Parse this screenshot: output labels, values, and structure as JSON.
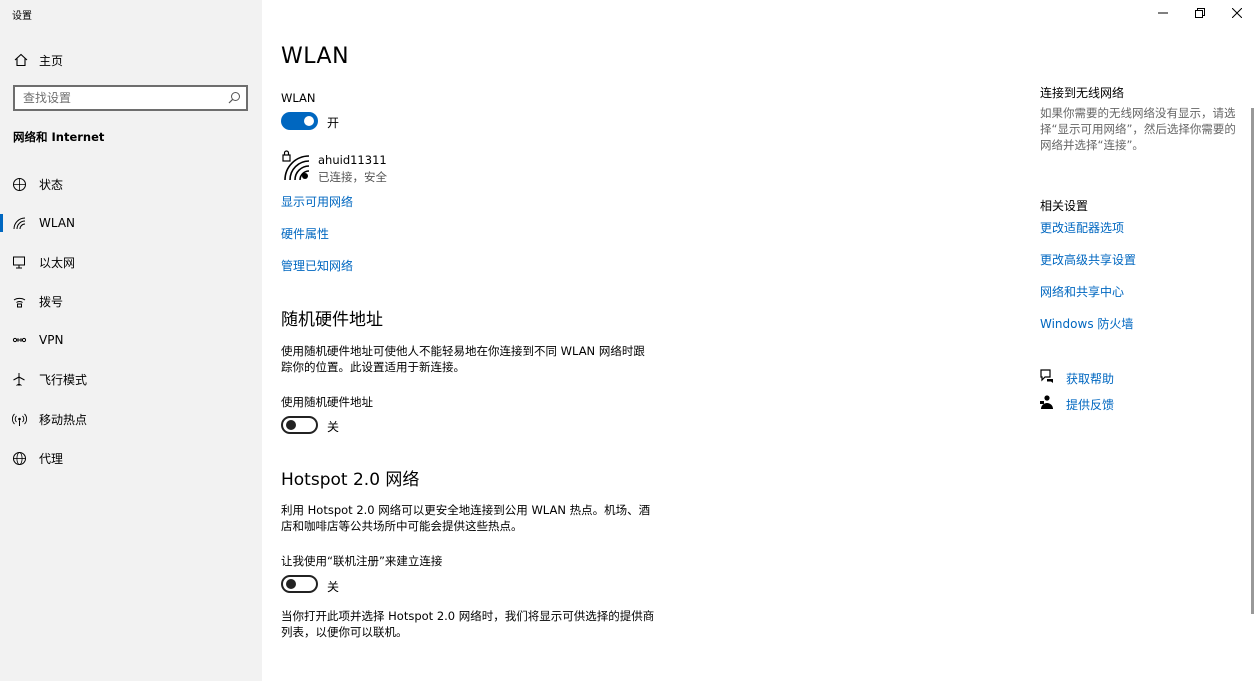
{
  "window": {
    "title": "设置"
  },
  "sidebar": {
    "home_label": "主页",
    "search_placeholder": "查找设置",
    "section_title": "网络和 Internet",
    "items": [
      {
        "label": "状态",
        "icon": "status-icon"
      },
      {
        "label": "WLAN",
        "icon": "wifi-icon",
        "active": true
      },
      {
        "label": "以太网",
        "icon": "ethernet-icon"
      },
      {
        "label": "拨号",
        "icon": "dialup-icon"
      },
      {
        "label": "VPN",
        "icon": "vpn-icon"
      },
      {
        "label": "飞行模式",
        "icon": "airplane-icon"
      },
      {
        "label": "移动热点",
        "icon": "hotspot-icon"
      },
      {
        "label": "代理",
        "icon": "globe-icon"
      }
    ]
  },
  "main": {
    "title": "WLAN",
    "wlan_label": "WLAN",
    "wlan_toggle_state": "开",
    "network": {
      "name": "ahuid11311",
      "status": "已连接，安全"
    },
    "links": [
      "显示可用网络",
      "硬件属性",
      "管理已知网络"
    ],
    "random_hw": {
      "heading": "随机硬件地址",
      "description": "使用随机硬件地址可使他人不能轻易地在你连接到不同 WLAN 网络时跟踪你的位置。此设置适用于新连接。",
      "toggle_label": "使用随机硬件地址",
      "toggle_state": "关"
    },
    "hotspot": {
      "heading": "Hotspot 2.0 网络",
      "description": "利用 Hotspot 2.0 网络可以更安全地连接到公用 WLAN 热点。机场、酒店和咖啡店等公共场所中可能会提供这些热点。",
      "toggle_label": "让我使用“联机注册”来建立连接",
      "toggle_state": "关",
      "note": "当你打开此项并选择 Hotspot 2.0 网络时，我们将显示可供选择的提供商列表，以便你可以联机。"
    }
  },
  "right_panel": {
    "connect_title": "连接到无线网络",
    "connect_text": "如果你需要的无线网络没有显示，请选择“显示可用网络”，然后选择你需要的网络并选择“连接”。",
    "related_title": "相关设置",
    "related_links": [
      "更改适配器选项",
      "更改高级共享设置",
      "网络和共享中心",
      "Windows 防火墙"
    ],
    "help_label": "获取帮助",
    "feedback_label": "提供反馈"
  },
  "colors": {
    "accent": "#0067c0",
    "sidebar_bg": "#f2f2f2"
  }
}
